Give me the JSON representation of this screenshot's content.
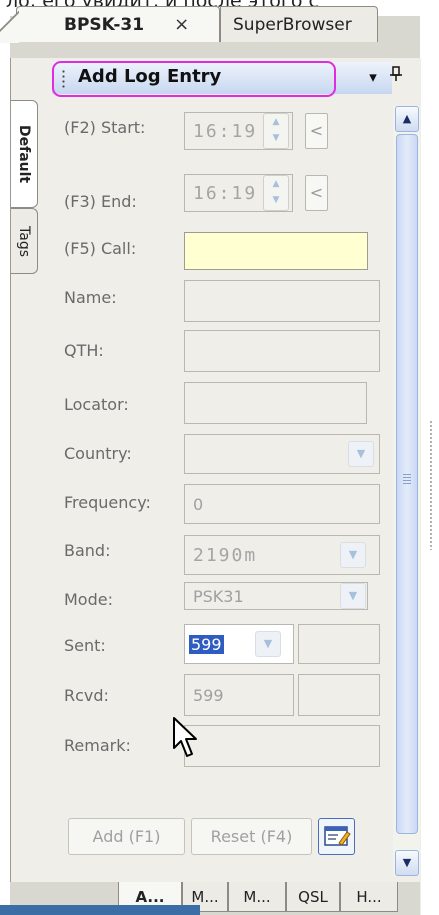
{
  "top_text": "ло; его увидит, и после этого с",
  "doc_tabs": [
    {
      "label": "BPSK-31",
      "close": "×"
    },
    {
      "label": "SuperBrowser"
    }
  ],
  "panel": {
    "title": "Add Log Entry",
    "dropdown_glyph": "▾",
    "pin_glyph": "ᴘ"
  },
  "side_tabs": [
    "Default",
    "Tags"
  ],
  "fields": {
    "start": {
      "label": "(F2)  Start:",
      "value": "16:19",
      "btn": "<"
    },
    "end": {
      "label": "(F3)  End:",
      "value": "16:19",
      "btn": "<"
    },
    "call": {
      "label": "(F5)  Call:",
      "value": ""
    },
    "name": {
      "label": "Name:",
      "value": ""
    },
    "qth": {
      "label": "QTH:",
      "value": ""
    },
    "locator": {
      "label": "Locator:",
      "value": ""
    },
    "country": {
      "label": "Country:",
      "value": ""
    },
    "frequency": {
      "label": "Frequency:",
      "value": "0"
    },
    "band": {
      "label": "Band:",
      "value": "2190m"
    },
    "mode": {
      "label": "Mode:",
      "value": "PSK31"
    },
    "sent": {
      "label": "Sent:",
      "value": "599"
    },
    "rcvd": {
      "label": "Rcvd:",
      "value": "599"
    },
    "remark": {
      "label": "Remark:",
      "value": ""
    }
  },
  "buttons": {
    "add": "Add (F1)",
    "reset": "Reset (F4)"
  },
  "bottom_tabs": [
    "A...",
    "M...",
    "M...",
    "QSL",
    "H..."
  ]
}
